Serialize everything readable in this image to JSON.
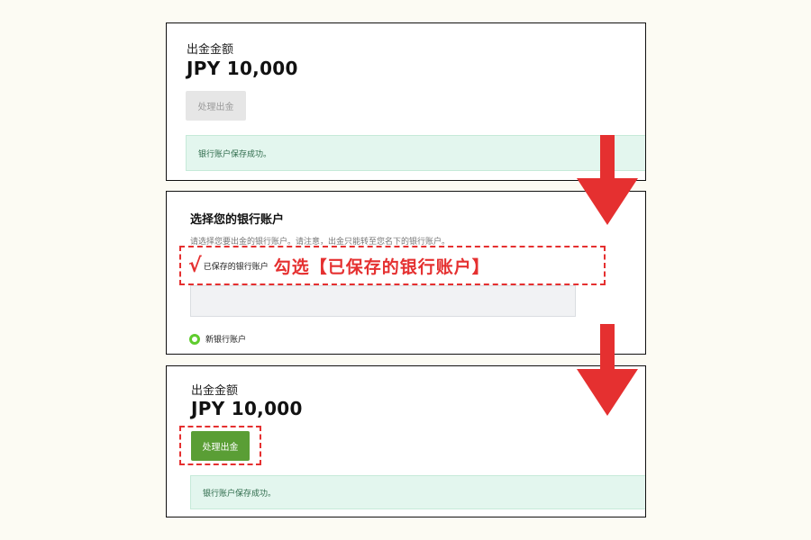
{
  "step1": {
    "amount_label": "出金金额",
    "amount_value": "JPY 10,000",
    "process_button": "处理出金",
    "success_message": "银行账户保存成功。"
  },
  "step2": {
    "title": "选择您的银行账户",
    "hint": "请选择您要出金的银行账户。请注意，出金只能转至您名下的银行账户。",
    "checkmark": "√",
    "saved_option": "已保存的银行账户",
    "annotation": "勾选【已保存的银行账户】",
    "new_option": "新银行账户"
  },
  "step3": {
    "amount_label": "出金金额",
    "amount_value": "JPY 10,000",
    "process_button": "处理出金",
    "success_message": "银行账户保存成功。"
  },
  "colors": {
    "annotation_red": "#e53030",
    "button_green": "#5a9e35",
    "radio_green": "#5fcc2e",
    "success_bg": "#e3f6ee"
  },
  "icons": [
    "down-arrow-icon",
    "down-arrow-icon",
    "radio-selected-icon"
  ]
}
